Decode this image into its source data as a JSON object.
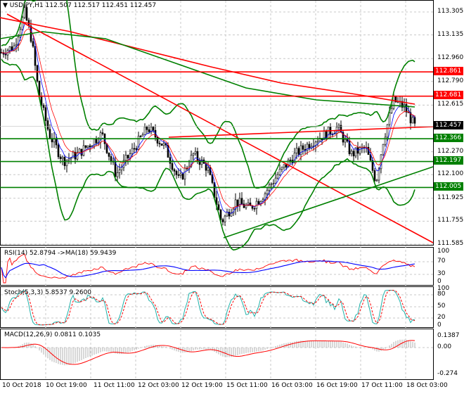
{
  "header": {
    "symbol": "USDJPY,H1",
    "ohlc": "112.507 112.517 112.451 112.457"
  },
  "price_axis": [
    "113.305",
    "113.135",
    "112.960",
    "112.790",
    "112.615",
    "112.270",
    "112.100",
    "111.925",
    "111.755",
    "111.585"
  ],
  "levels": {
    "red": [
      {
        "value": "112.861"
      },
      {
        "value": "112.681"
      }
    ],
    "green": [
      {
        "value": "112.366"
      },
      {
        "value": "112.197"
      },
      {
        "value": "112.005"
      }
    ],
    "current": "112.457"
  },
  "colors": {
    "bull": "#000000",
    "bear": "#000000",
    "red": "#ff0000",
    "green": "#008000",
    "blue": "#0000ff",
    "teal": "#20b2aa",
    "current_bg": "#000000"
  },
  "indicators": {
    "rsi": {
      "label": "RSI(14) 52.8794  ->MA(18) 59.9439",
      "axis": [
        "100",
        "70",
        "30",
        "0"
      ]
    },
    "stoch": {
      "label": "Stoch(5,3,3) 5.8537 9.2600",
      "axis": [
        "100",
        "80",
        "50",
        "20",
        "0"
      ]
    },
    "macd": {
      "label": "MACD(12,26,9) 0.0811 0.1035",
      "axis": [
        "0.1387",
        "0.00",
        "-0.274"
      ]
    }
  },
  "time_axis": [
    "10 Oct 2018",
    "10 Oct 19:00",
    "11 Oct 11:00",
    "12 Oct 03:00",
    "12 Oct 19:00",
    "15 Oct 11:00",
    "16 Oct 03:00",
    "16 Oct 19:00",
    "17 Oct 11:00",
    "18 Oct 03:00"
  ],
  "chart_data": {
    "type": "candlestick",
    "price_path": [
      [
        0,
        113.0
      ],
      [
        20,
        113.05
      ],
      [
        35,
        113.3
      ],
      [
        45,
        113.1
      ],
      [
        55,
        112.7
      ],
      [
        70,
        112.4
      ],
      [
        90,
        112.2
      ],
      [
        110,
        112.25
      ],
      [
        145,
        112.4
      ],
      [
        165,
        112.1
      ],
      [
        185,
        112.25
      ],
      [
        210,
        112.45
      ],
      [
        235,
        112.3
      ],
      [
        255,
        112.05
      ],
      [
        275,
        112.25
      ],
      [
        295,
        112.15
      ],
      [
        315,
        111.75
      ],
      [
        335,
        111.9
      ],
      [
        355,
        111.85
      ],
      [
        375,
        111.95
      ],
      [
        395,
        112.1
      ],
      [
        420,
        112.25
      ],
      [
        445,
        112.35
      ],
      [
        480,
        112.45
      ],
      [
        500,
        112.25
      ],
      [
        520,
        112.3
      ],
      [
        535,
        112.05
      ],
      [
        545,
        112.35
      ],
      [
        560,
        112.65
      ],
      [
        575,
        112.6
      ],
      [
        590,
        112.457
      ]
    ],
    "ylim": [
      111.585,
      113.305
    ]
  }
}
